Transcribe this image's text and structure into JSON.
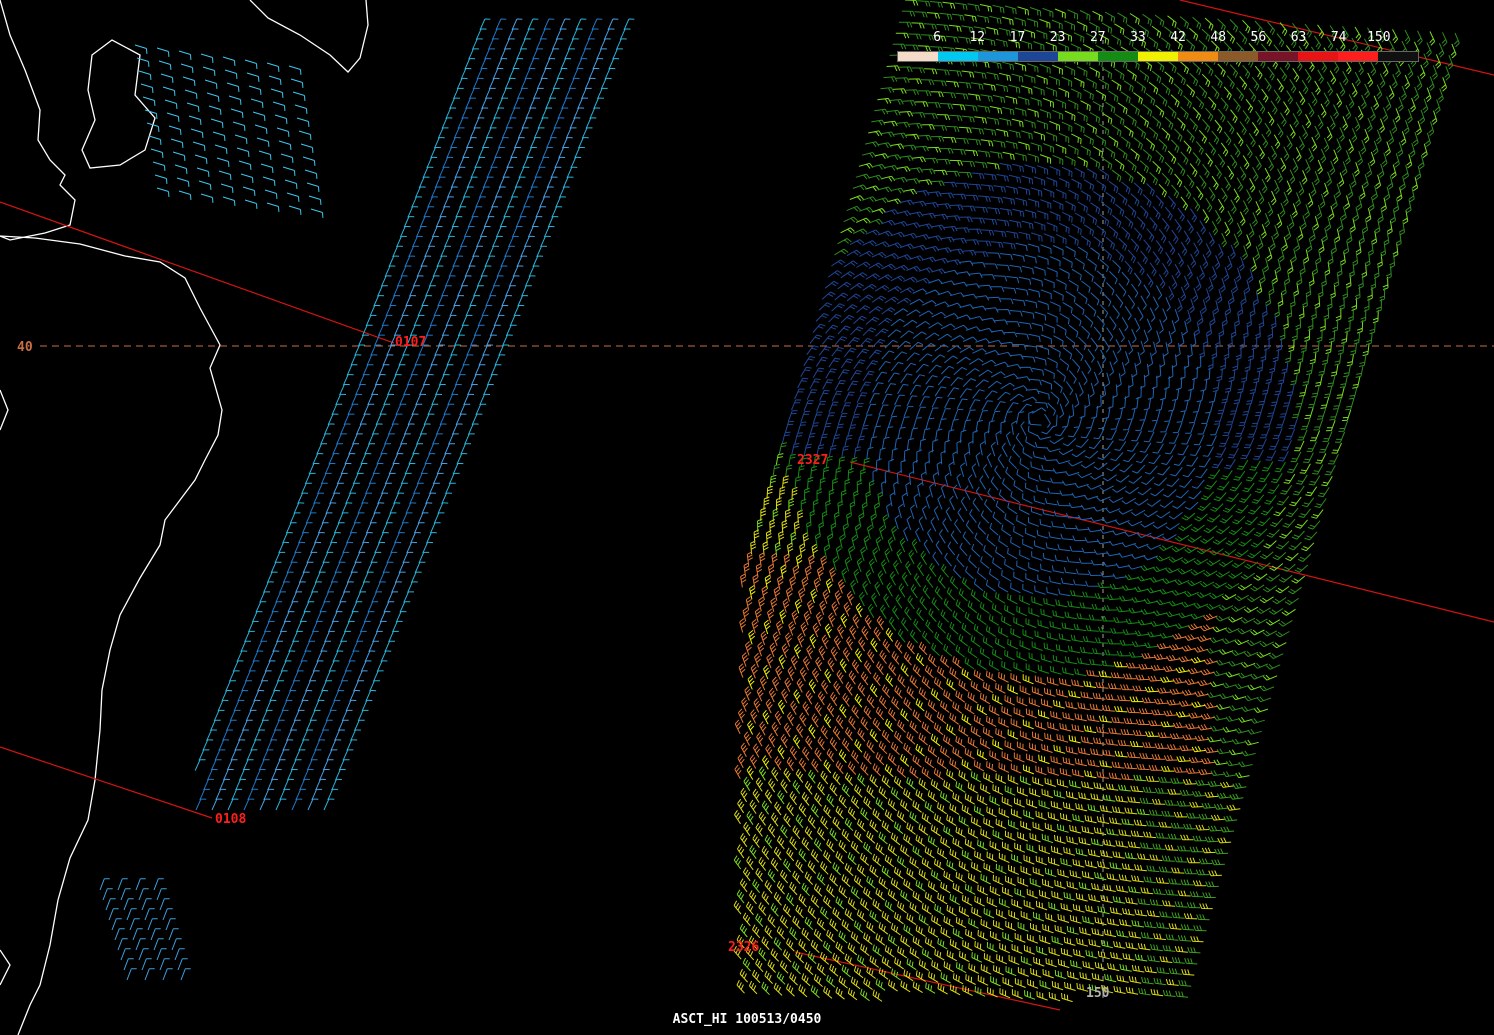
{
  "product": "ASCT_HI 100513/0450",
  "latitude_label": "40",
  "longitude_label": "150",
  "pass_times": [
    "0107",
    "0108",
    "2327",
    "2326"
  ],
  "legend": {
    "ticks": [
      "6",
      "12",
      "17",
      "23",
      "27",
      "33",
      "42",
      "48",
      "56",
      "63",
      "74",
      "150"
    ],
    "colors": [
      "#f5dcc8",
      "#00c8f0",
      "#1e96dc",
      "#1e4696",
      "#78dc1e",
      "#148c14",
      "#f0f000",
      "#f08c14",
      "#8c5a28",
      "#781428",
      "#e61414",
      "#ff1e1e",
      "#101010"
    ]
  },
  "colors": {
    "background": "#000000",
    "coastline": "#ffffff",
    "orbit_track": "#d21414",
    "gridline": "#c86e46",
    "pass_label": "#ff1e1e"
  }
}
